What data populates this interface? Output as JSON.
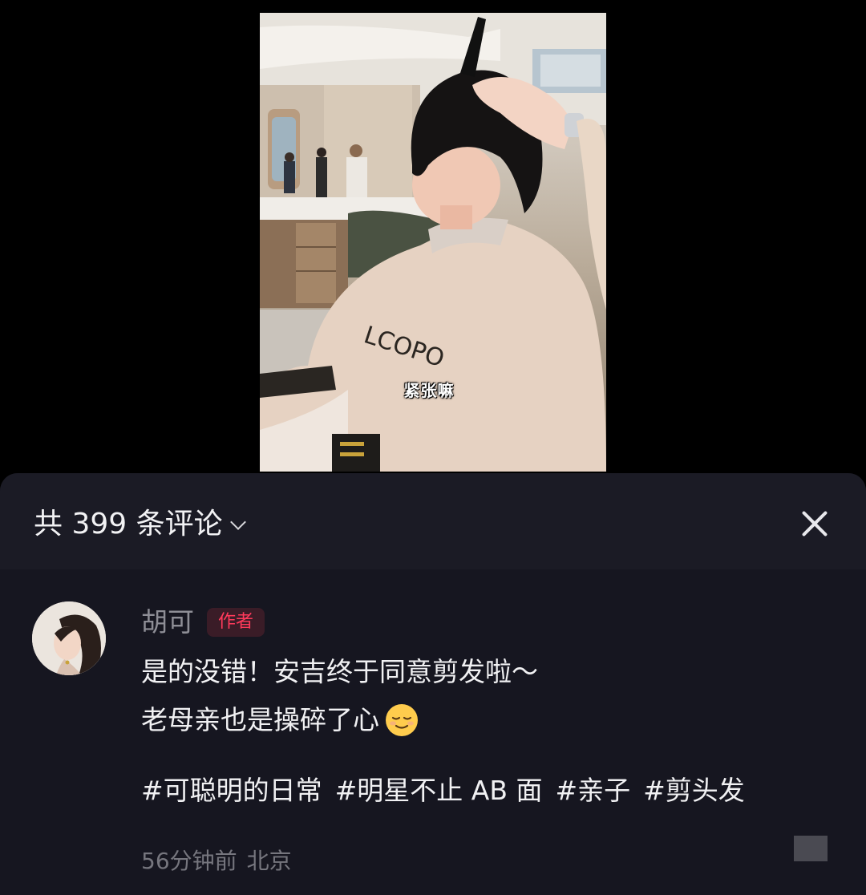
{
  "video": {
    "subtitle": "紧张嘛",
    "shirt_text": "LCOPO"
  },
  "comments_panel": {
    "count_title": "共 399 条评论",
    "close_icon": "close-icon",
    "expand_icon": "chevron-down-icon"
  },
  "comment": {
    "author": "胡可",
    "badge": "作者",
    "line1": "是的没错！安吉终于同意剪发啦～",
    "line2": "老母亲也是操碎了心",
    "emoji": "relieved-face-emoji",
    "hashtags": [
      "#可聪明的日常",
      "#明星不止 AB 面",
      "#亲子",
      "#剪头发"
    ],
    "time": "56分钟前",
    "location": "北京"
  },
  "colors": {
    "background": "#000000",
    "sheet": "#161620",
    "badge_text": "#ff3a5b",
    "badge_bg": "#3a1c27",
    "muted": "#8e8e96"
  }
}
